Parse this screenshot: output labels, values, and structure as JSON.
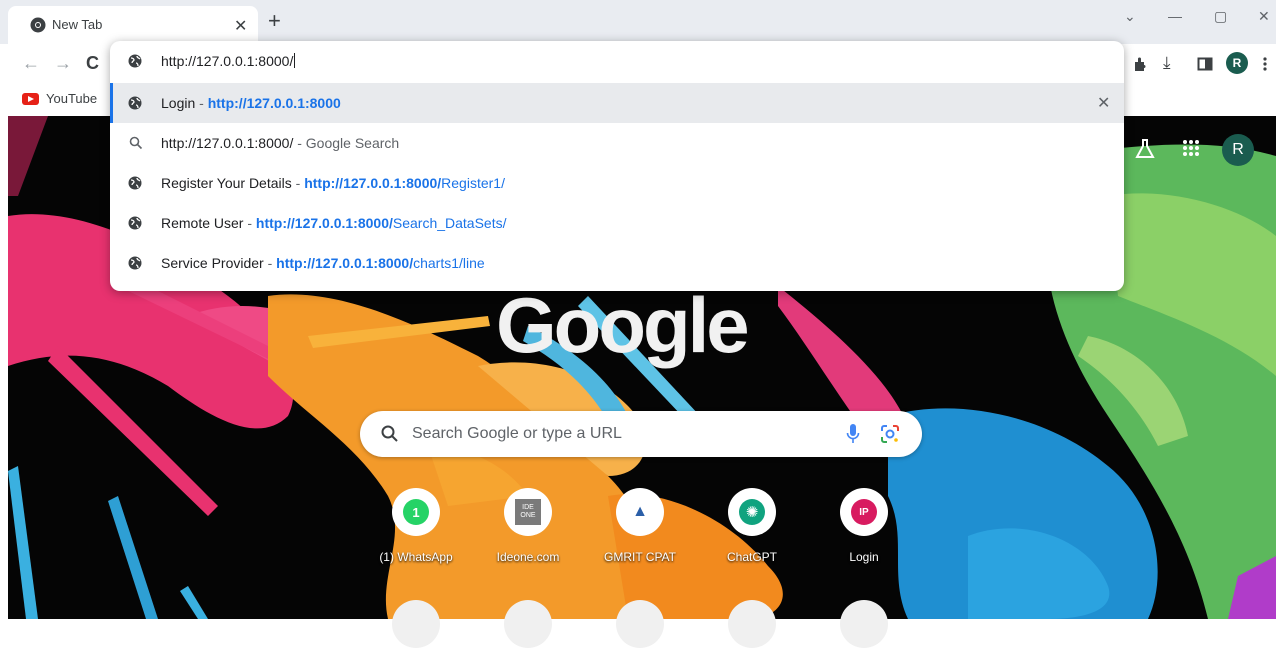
{
  "tab": {
    "title": "New Tab",
    "close": "✕",
    "new": "+"
  },
  "window": {
    "chevron": "⌄",
    "minimize": "—",
    "restore": "▢",
    "close": "✕"
  },
  "toolbar": {
    "back": "←",
    "forward": "→",
    "reload": "C",
    "download": "⤓",
    "avatar_initial": "R"
  },
  "bookmarks": [
    {
      "label": "YouTube"
    }
  ],
  "omnibox": {
    "input": "http://127.0.0.1:8000/",
    "suggestions": [
      {
        "title": "Login",
        "sep": " - ",
        "url_bold": "http://127.0.0.1:8000",
        "url_rest": "",
        "icon": "globe-icon",
        "selected": true
      },
      {
        "query": "http://127.0.0.1:8000/",
        "suffix": " - Google Search",
        "icon": "search-icon"
      },
      {
        "title": "Register Your Details",
        "sep": " - ",
        "url_bold": "http://127.0.0.1:8000/",
        "url_rest": "Register1/",
        "icon": "globe-icon"
      },
      {
        "title": "Remote User",
        "sep": " - ",
        "url_bold": "http://127.0.0.1:8000/",
        "url_rest": "Search_DataSets/",
        "icon": "globe-icon"
      },
      {
        "title": "Service Provider",
        "sep": " - ",
        "url_bold": "http://127.0.0.1:8000/",
        "url_rest": "charts1/line",
        "icon": "globe-icon"
      }
    ],
    "remove": "✕"
  },
  "ntp": {
    "logo": "Google",
    "search_placeholder": "Search Google or type a URL",
    "avatar_initial": "R",
    "shortcuts": [
      {
        "label": "(1) WhatsApp",
        "glyph": "1",
        "color": "#25d366"
      },
      {
        "label": "Ideone.com",
        "glyph": "IDE ONE",
        "color": "#7a7a7a"
      },
      {
        "label": "GMRIT CPAT",
        "glyph": "▲",
        "color": "#2b5fa8"
      },
      {
        "label": "ChatGPT",
        "glyph": "✺",
        "color": "#10a37f"
      },
      {
        "label": "Login",
        "glyph": "IP",
        "color": "#d81b60"
      }
    ]
  }
}
